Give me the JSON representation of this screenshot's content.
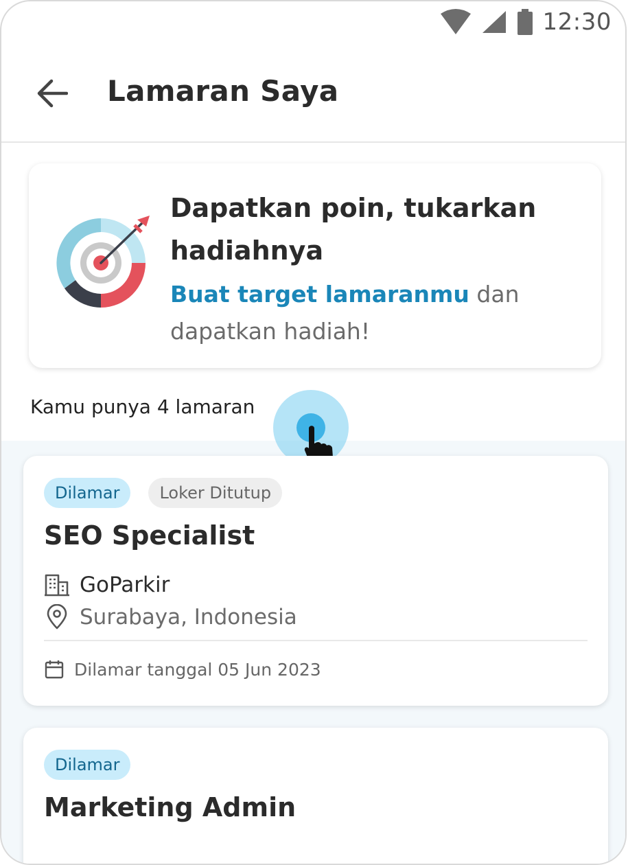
{
  "status_bar": {
    "time": "12:30",
    "icons": [
      "wifi-icon",
      "signal-icon",
      "battery-icon"
    ]
  },
  "header": {
    "back_icon": "arrow-left-icon",
    "title": "Lamaran Saya"
  },
  "promo": {
    "illustration": "target-icon",
    "title": "Dapatkan poin, tukarkan hadiahnya",
    "link_text": "Buat target lamaranmu",
    "desc_rest": " dan dapatkan hadiah!"
  },
  "applications": {
    "count_text": "Kamu punya 4 lamaran",
    "items": [
      {
        "status_badge": "Dilamar",
        "closed_badge": "Loker Ditutup",
        "title": "SEO Specialist",
        "company": "GoParkir",
        "location": "Surabaya, Indonesia",
        "applied_date": "Dilamar tanggal 05 Jun 2023"
      },
      {
        "status_badge": "Dilamar",
        "title": "Marketing Admin"
      }
    ]
  },
  "colors": {
    "accent": "#1a86b8",
    "badge_applied_bg": "#c9ecfb",
    "badge_applied_text": "#13668e",
    "badge_closed_bg": "#eeeeee",
    "list_background": "#f3f8fb"
  }
}
